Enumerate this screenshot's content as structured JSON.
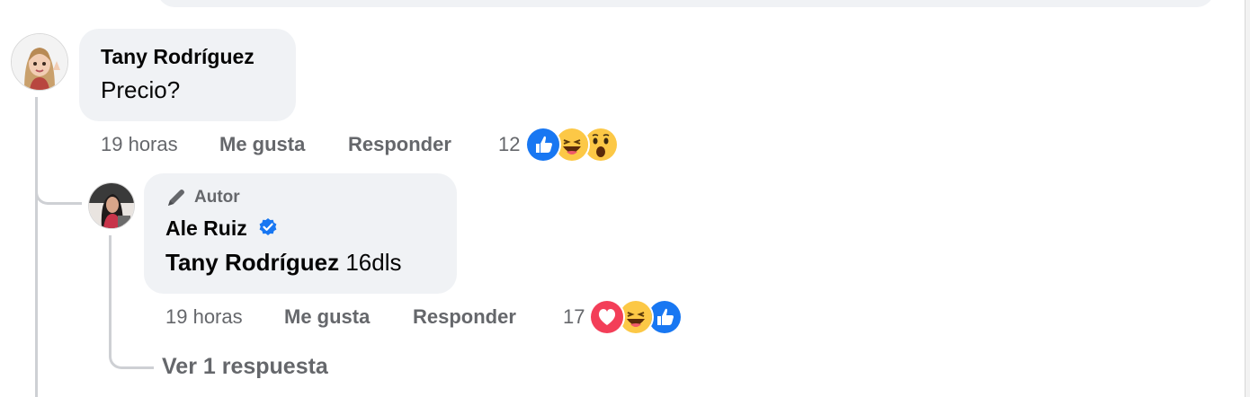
{
  "comment": {
    "author": "Tany Rodríguez",
    "text": "Precio?",
    "time": "19 horas",
    "like_label": "Me gusta",
    "reply_label": "Responder",
    "reaction_count": "12",
    "reactions": [
      "like-icon",
      "laugh-icon",
      "wow-icon"
    ]
  },
  "reply": {
    "badge": "Autor",
    "author": "Ale Ruiz",
    "verified": true,
    "mention": "Tany Rodríguez",
    "text": "16dls",
    "time": "19 horas",
    "like_label": "Me gusta",
    "reply_label": "Responder",
    "reaction_count": "17",
    "reactions": [
      "love-icon",
      "laugh-icon",
      "like-icon"
    ],
    "view_replies": "Ver 1 respuesta"
  },
  "colors": {
    "bubble": "#f0f2f5",
    "secondary_text": "#65676b",
    "like_blue": "#1877f2",
    "love_red": "#f33e58",
    "emoji_yellow": "#fcc846"
  }
}
